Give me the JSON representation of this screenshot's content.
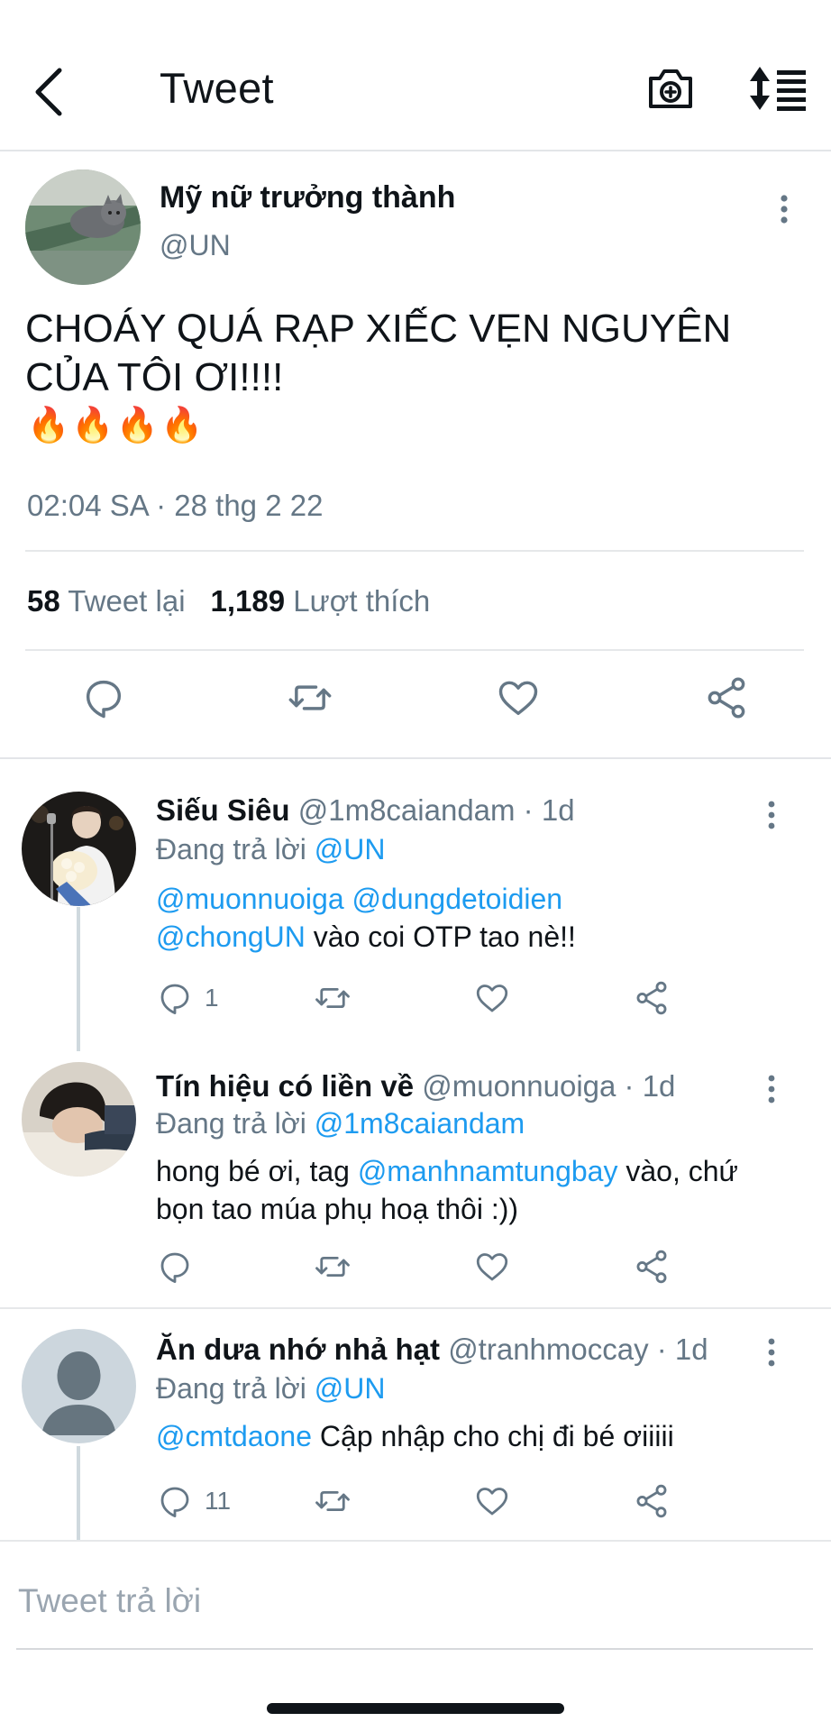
{
  "header": {
    "title": "Tweet",
    "back_icon": "chevron-left-icon",
    "camera_icon": "camera-plus-icon",
    "sort_icon": "sort-list-icon"
  },
  "main_tweet": {
    "author_name": "Mỹ nữ trưởng thành",
    "author_handle": "@UN",
    "text": "CHOÁY QUÁ RẠP XIẾC VẸN NGUYÊN CỦA TÔI ƠI!!!!",
    "emoji": "🔥🔥🔥🔥",
    "timestamp": "02:04 SA · 28 thg 2 22",
    "retweets_count": "58",
    "retweets_label": "Tweet lại",
    "likes_count": "1,189",
    "likes_label": "Lượt thích"
  },
  "replies": [
    {
      "name": "Siếu Siêu",
      "meta": "@1m8caiandam · 1d",
      "replying_prefix": "Đang trả lời ",
      "replying_to": "@UN",
      "mention1": "@muonnuoiga",
      "mention2": "@dungdetoidien",
      "mention3": "@chongUN",
      "text": " vào coi OTP tao nè!!",
      "reply_count": "1"
    },
    {
      "name": "Tín hiệu có liền về",
      "meta": "@muonnuoiga · 1d",
      "replying_prefix": "Đang trả lời ",
      "replying_to": "@1m8caiandam",
      "text_before": "hong bé ơi, tag ",
      "mention": "@manhnamtungbay",
      "text_after": " vào, chứ bọn tao múa phụ hoạ thôi :))",
      "reply_count": ""
    },
    {
      "name": "Ăn dưa nhớ nhả hạt",
      "meta": "@tranhmoccay · 1d",
      "replying_prefix": "Đang trả lời ",
      "replying_to": "@UN",
      "mention": "@cmtdaone",
      "text": " Cập nhập cho chị đi bé ơiiiii",
      "reply_count": "11"
    }
  ],
  "compose": {
    "placeholder": "Tweet trả lời"
  },
  "colors": {
    "link": "#1d9bf0",
    "secondary_text": "#657786",
    "divider": "#e6e8ea"
  }
}
